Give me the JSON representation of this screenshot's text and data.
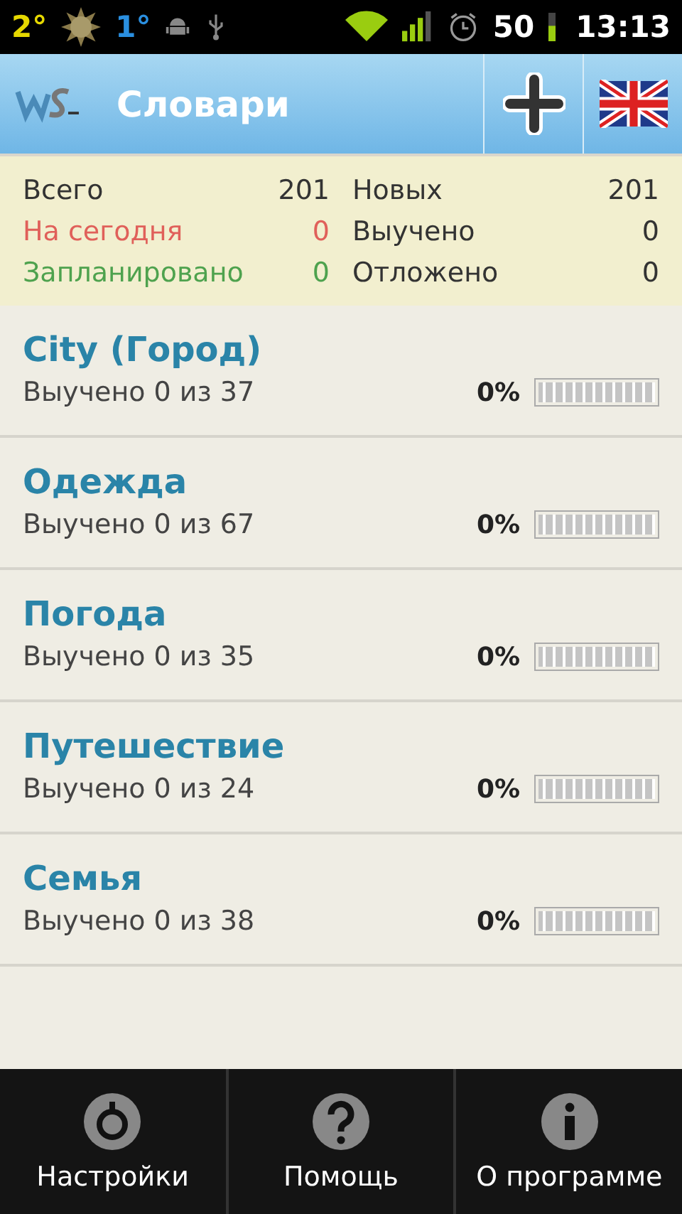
{
  "status_bar": {
    "weather_1": "2°",
    "weather_2": "1°",
    "battery": "50",
    "time": "13:13"
  },
  "header": {
    "title": "Словари"
  },
  "stats": [
    {
      "label": "Всего",
      "value": "201",
      "color": "#333333"
    },
    {
      "label": "Новых",
      "value": "201",
      "color": "#333333"
    },
    {
      "label": "На сегодня",
      "value": "0",
      "color": "#e0605a"
    },
    {
      "label": "Выучено",
      "value": "0",
      "color": "#333333"
    },
    {
      "label": "Запланировано",
      "value": "0",
      "color": "#4ea24e"
    },
    {
      "label": "Отложено",
      "value": "0",
      "color": "#333333"
    }
  ],
  "dictionaries": [
    {
      "name": "City (Город)",
      "progress": "Выучено 0 из 37",
      "percent": "0%"
    },
    {
      "name": "Одежда",
      "progress": "Выучено 0 из 67",
      "percent": "0%"
    },
    {
      "name": "Погода",
      "progress": "Выучено 0 из 35",
      "percent": "0%"
    },
    {
      "name": "Путешествие",
      "progress": "Выучено 0 из 24",
      "percent": "0%"
    },
    {
      "name": "Семья",
      "progress": "Выучено 0 из 38",
      "percent": "0%"
    }
  ],
  "menu": [
    {
      "label": "Настройки",
      "kind": "settings"
    },
    {
      "label": "Помощь",
      "kind": "help"
    },
    {
      "label": "О программе",
      "kind": "about"
    }
  ]
}
